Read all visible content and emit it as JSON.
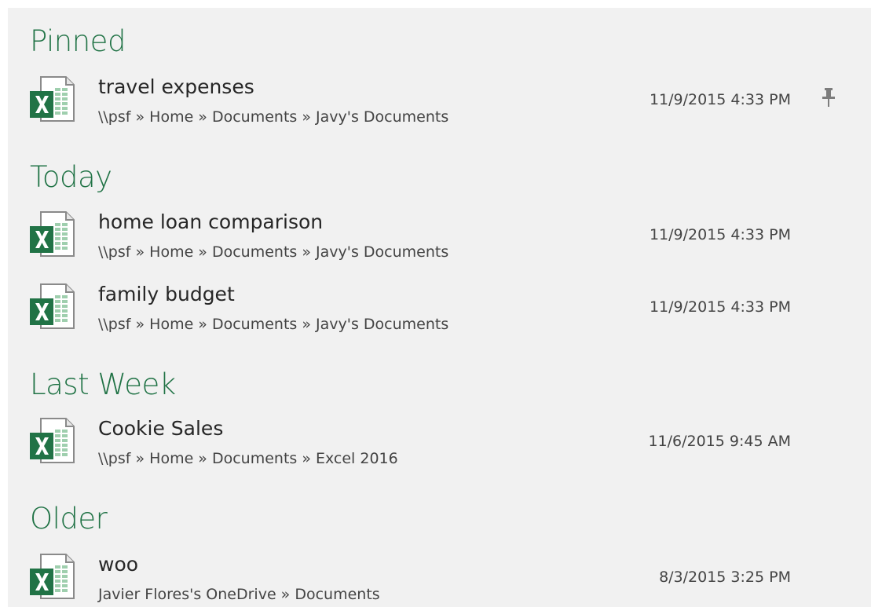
{
  "groups": [
    {
      "title": "Pinned",
      "files": [
        {
          "name": "travel expenses",
          "path": "\\\\psf » Home » Documents » Javy's Documents",
          "date": "11/9/2015 4:33 PM",
          "pinned": true,
          "icon": "excel-file-icon"
        }
      ]
    },
    {
      "title": "Today",
      "files": [
        {
          "name": "home loan comparison",
          "path": "\\\\psf » Home » Documents » Javy's Documents",
          "date": "11/9/2015 4:33 PM",
          "pinned": false,
          "icon": "excel-file-icon"
        },
        {
          "name": "family budget",
          "path": "\\\\psf » Home » Documents » Javy's Documents",
          "date": "11/9/2015 4:33 PM",
          "pinned": false,
          "icon": "excel-file-icon"
        }
      ]
    },
    {
      "title": "Last Week",
      "files": [
        {
          "name": "Cookie Sales",
          "path": "\\\\psf » Home » Documents » Excel 2016",
          "date": "11/6/2015 9:45 AM",
          "pinned": false,
          "icon": "excel-file-icon"
        }
      ]
    },
    {
      "title": "Older",
      "files": [
        {
          "name": "woo",
          "path": "Javier Flores's OneDrive » Documents",
          "date": "8/3/2015 3:25 PM",
          "pinned": false,
          "icon": "excel-file-icon"
        }
      ]
    }
  ],
  "colors": {
    "accent": "#217346",
    "background": "#f1f1f1",
    "text": "#262626",
    "subtext": "#444444"
  }
}
